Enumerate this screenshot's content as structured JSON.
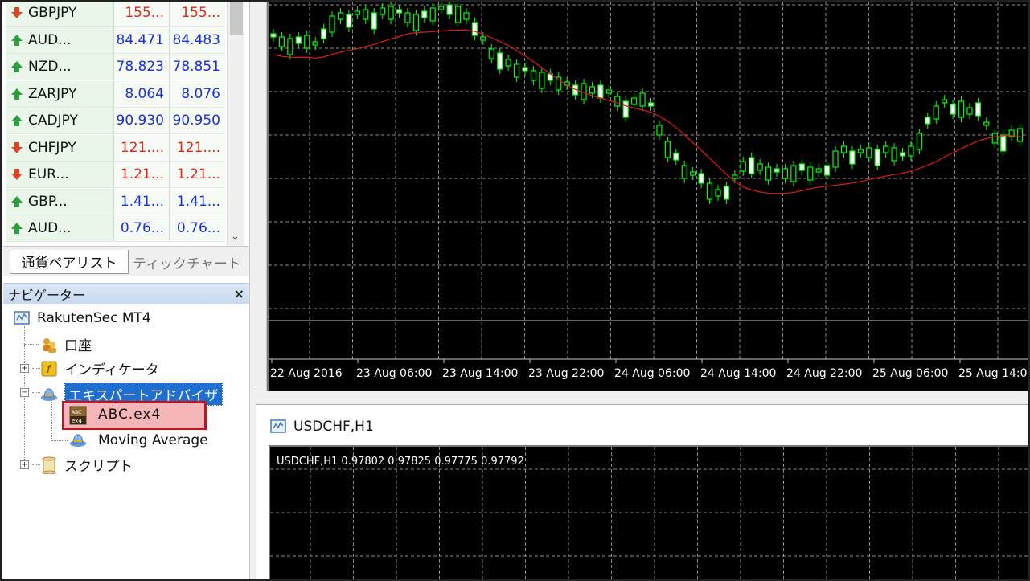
{
  "market_watch": {
    "rows": [
      {
        "symbol": "GBPJPY",
        "bid": "155...",
        "ask": "155...",
        "direction": "down",
        "color": "red"
      },
      {
        "symbol": "AUD...",
        "bid": "84.471",
        "ask": "84.483",
        "direction": "up",
        "color": "blue"
      },
      {
        "symbol": "NZD...",
        "bid": "78.823",
        "ask": "78.851",
        "direction": "up",
        "color": "blue"
      },
      {
        "symbol": "ZARJPY",
        "bid": "8.064",
        "ask": "8.076",
        "direction": "up",
        "color": "blue"
      },
      {
        "symbol": "CADJPY",
        "bid": "90.930",
        "ask": "90.950",
        "direction": "up",
        "color": "blue"
      },
      {
        "symbol": "CHFJPY",
        "bid": "121....",
        "ask": "121....",
        "direction": "down",
        "color": "red"
      },
      {
        "symbol": "EUR...",
        "bid": "1.21...",
        "ask": "1.21...",
        "direction": "down",
        "color": "red"
      },
      {
        "symbol": "GBP...",
        "bid": "1.41...",
        "ask": "1.41...",
        "direction": "up",
        "color": "blue"
      },
      {
        "symbol": "AUD...",
        "bid": "0.76...",
        "ask": "0.76...",
        "direction": "up",
        "color": "blue"
      }
    ],
    "tabs": {
      "symbols": "通貨ペアリスト",
      "tick_chart": "ティックチャート"
    }
  },
  "navigator": {
    "title": "ナビゲーター",
    "close": "×",
    "root": "RakutenSec MT4",
    "accounts": "口座",
    "indicators": "インディケータ",
    "experts": "エキスパートアドバイザ",
    "expert_items": [
      "ABC.ex4",
      "Moving Average"
    ],
    "scripts": "スクリプト",
    "file_icon_text": {
      "top": "ABC",
      "bottom": "ex4"
    }
  },
  "chart_main": {
    "x_labels": [
      "22 Aug 2016",
      "23 Aug 06:00",
      "23 Aug 14:00",
      "23 Aug 22:00",
      "24 Aug 06:00",
      "24 Aug 14:00",
      "24 Aug 22:00",
      "25 Aug 06:00",
      "25 Aug 14:00"
    ],
    "colors": {
      "background": "#000000",
      "grid": "#8a8a8a",
      "candle": "#00ff00",
      "ma_line": "#e01818"
    }
  },
  "chart_second": {
    "window_title": "USDCHF,H1",
    "ohlc_label": "USDCHF,H1  0.97802 0.97825 0.97775 0.97792"
  },
  "colors": {
    "accent_blue": "#1f6fd0",
    "highlight_red": "#c4121e",
    "up_green": "#2f9e3f",
    "down_red": "#d9462a"
  }
}
